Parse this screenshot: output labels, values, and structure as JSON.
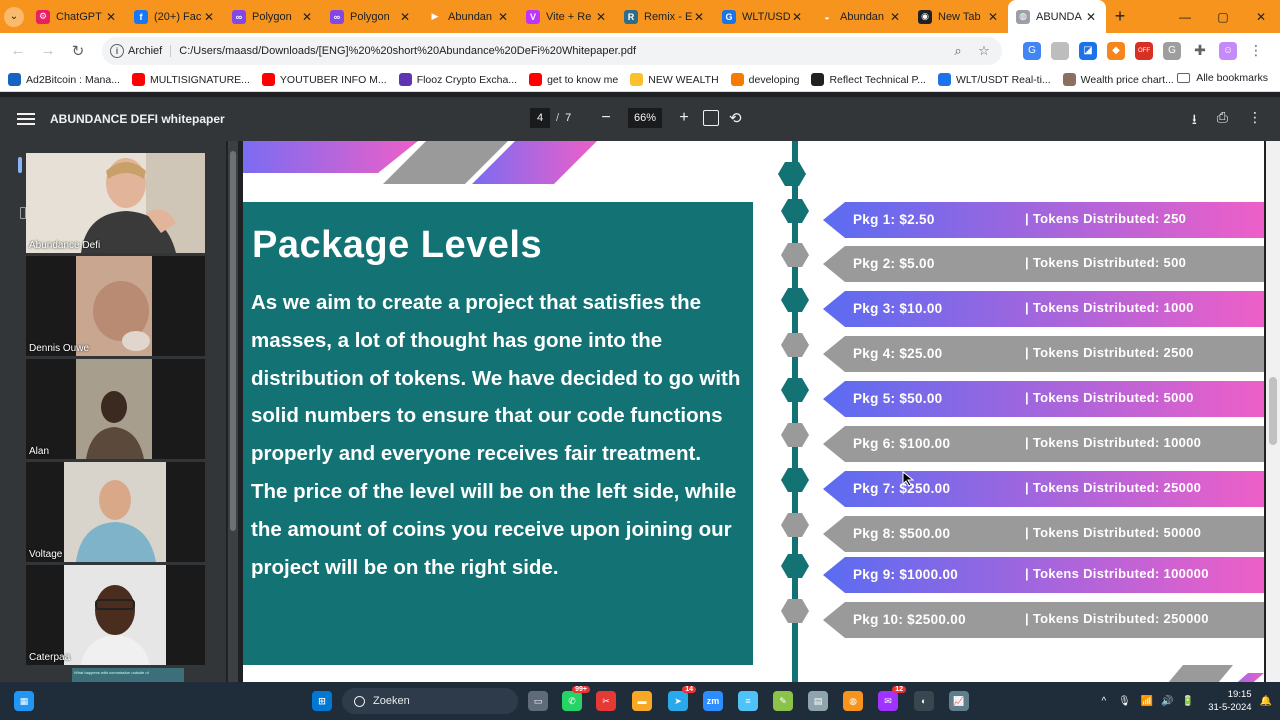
{
  "browser": {
    "tabs": [
      {
        "title": "ChatGPT",
        "color": "#e91e63",
        "glyph": "⚙"
      },
      {
        "title": "(20+) Fac",
        "color": "#1877f2",
        "glyph": "f"
      },
      {
        "title": "Polygon",
        "color": "#8247e5",
        "glyph": "∞"
      },
      {
        "title": "Polygon",
        "color": "#8247e5",
        "glyph": "∞"
      },
      {
        "title": "Abundan",
        "color": "#f7941d",
        "glyph": "▶"
      },
      {
        "title": "Vite + Re",
        "color": "#bd34fe",
        "glyph": "V"
      },
      {
        "title": "Remix - E",
        "color": "#2c6d8c",
        "glyph": "R"
      },
      {
        "title": "WLT/USD",
        "color": "#1a73e8",
        "glyph": "G"
      },
      {
        "title": "Abundan",
        "color": "#f7941d",
        "glyph": "◒"
      },
      {
        "title": "New Tab",
        "color": "#202124",
        "glyph": "◉"
      }
    ],
    "active_tab": {
      "title": "ABUNDA",
      "glyph": "◍"
    },
    "close_glyph": "✕",
    "new_tab_glyph": "+",
    "tab_menu_glyph": "⌄",
    "window": {
      "minimize": "—",
      "maximize": "▢",
      "close": "✕"
    },
    "nav": {
      "back": "←",
      "forward": "→",
      "reload": "↻"
    },
    "address": {
      "chip": "Archief",
      "url": "C:/Users/maasd/Downloads/[ENG]%20%20short%20Abundance%20DeFi%20Whitepaper.pdf",
      "zoom_glyph": "⌕",
      "star_glyph": "☆"
    },
    "extensions": [
      {
        "name": "translate",
        "color": "#4285f4",
        "glyph": "G"
      },
      {
        "name": "ext-grey",
        "color": "#bdbdbd",
        "glyph": ""
      },
      {
        "name": "ext-blue",
        "color": "#1a73e8",
        "glyph": "◪"
      },
      {
        "name": "metamask",
        "color": "#f6851b",
        "glyph": "◆"
      },
      {
        "name": "off-ext",
        "color": "#d93025",
        "glyph": "OFF"
      },
      {
        "name": "ext-g",
        "color": "#9e9e9e",
        "glyph": "G"
      },
      {
        "name": "puzzle",
        "color": "#5f6368",
        "glyph": "✚"
      },
      {
        "name": "profile",
        "color": "#c58af9",
        "glyph": "☺"
      },
      {
        "name": "menu",
        "color": "#5f6368",
        "glyph": "⋮"
      }
    ],
    "bookmarks": [
      {
        "label": "Ad2Bitcoin : Mana...",
        "color": "#1565c0"
      },
      {
        "label": "MULTISIGNATURE...",
        "color": "#ff0000"
      },
      {
        "label": "YOUTUBER INFO M...",
        "color": "#ff0000"
      },
      {
        "label": "Flooz Crypto Excha...",
        "color": "#5e35b1"
      },
      {
        "label": "get to know me",
        "color": "#ff0000"
      },
      {
        "label": "NEW WEALTH",
        "color": "#fbc02d"
      },
      {
        "label": "developing",
        "color": "#f57c00"
      },
      {
        "label": "Reflect Technical P...",
        "color": "#212121"
      },
      {
        "label": "WLT/USDT Real-ti...",
        "color": "#1a73e8"
      },
      {
        "label": "Wealth price chart...",
        "color": "#8d6e63"
      }
    ],
    "all_bookmarks": "Alle bookmarks"
  },
  "pdf": {
    "title": "ABUNDANCE DEFI whitepaper",
    "page_current": "4",
    "page_total": "7",
    "page_separator": "/",
    "zoom": "66%",
    "zoom_out": "−",
    "zoom_in": "+",
    "rotate_glyph": "⟲",
    "download_glyph": "⭳",
    "print_glyph": "⎙",
    "more_glyph": "⋮"
  },
  "participants": [
    {
      "name": "Abundance Defi"
    },
    {
      "name": "Dennis Ouwe"
    },
    {
      "name": "Alan"
    },
    {
      "name": "Voltage"
    },
    {
      "name": "Caterpaa"
    }
  ],
  "chat_preview": "What happens with commission outside of",
  "page_content": {
    "heading": "Package Levels",
    "body": "As we aim to create a project that satisfies the masses, a lot of thought has gone into the distribution of tokens. We have decided to go with solid numbers to ensure that our code functions properly and everyone receives fair treatment. The price of the level will be on the left side, while the amount of coins you receive upon joining our project will be on the right side.",
    "packages": [
      {
        "price": "Pkg 1:  $2.50",
        "tokens": "| Tokens Distributed: 250",
        "style": "gradient"
      },
      {
        "price": "Pkg 2:  $5.00",
        "tokens": "| Tokens Distributed: 500",
        "style": "grey"
      },
      {
        "price": "Pkg 3:  $10.00",
        "tokens": "| Tokens Distributed: 1000",
        "style": "gradient"
      },
      {
        "price": "Pkg 4:  $25.00",
        "tokens": "| Tokens Distributed: 2500",
        "style": "grey"
      },
      {
        "price": "Pkg 5:  $50.00",
        "tokens": "| Tokens Distributed: 5000",
        "style": "gradient"
      },
      {
        "price": "Pkg 6:  $100.00",
        "tokens": "| Tokens Distributed: 10000",
        "style": "grey"
      },
      {
        "price": "Pkg 7:  $250.00",
        "tokens": "| Tokens Distributed: 25000",
        "style": "gradient"
      },
      {
        "price": "Pkg 8:  $500.00",
        "tokens": "| Tokens Distributed: 50000",
        "style": "grey"
      },
      {
        "price": "Pkg 9:  $1000.00",
        "tokens": "| Tokens Distributed: 100000",
        "style": "gradient"
      },
      {
        "price": "Pkg 10:  $2500.00",
        "tokens": "| Tokens Distributed: 250000",
        "style": "grey"
      }
    ],
    "colors": {
      "teal": "#137274",
      "grey": "#9a9a9a",
      "gradient_start": "#5a6cf2",
      "gradient_end": "#ee5fc8"
    }
  },
  "taskbar": {
    "search_placeholder": "Zoeken",
    "apps": [
      {
        "name": "widgets",
        "color": "#2196f3",
        "glyph": "▦",
        "badge": ""
      },
      {
        "name": "start",
        "color": "#0078d4",
        "glyph": "⊞",
        "badge": ""
      },
      {
        "name": "task-view",
        "color": "#5f6b78",
        "glyph": "▭",
        "badge": ""
      },
      {
        "name": "whatsapp",
        "color": "#25d366",
        "glyph": "✆",
        "badge": "99+"
      },
      {
        "name": "snip",
        "color": "#e53935",
        "glyph": "✂",
        "badge": ""
      },
      {
        "name": "explorer",
        "color": "#f9a825",
        "glyph": "▬",
        "badge": ""
      },
      {
        "name": "telegram",
        "color": "#29a9eb",
        "glyph": "➤",
        "badge": "14"
      },
      {
        "name": "zoom",
        "color": "#2d8cff",
        "glyph": "zm",
        "badge": ""
      },
      {
        "name": "notepad",
        "color": "#4fc3f7",
        "glyph": "≡",
        "badge": ""
      },
      {
        "name": "editor",
        "color": "#8bc34a",
        "glyph": "✎",
        "badge": ""
      },
      {
        "name": "calculator",
        "color": "#90a4ae",
        "glyph": "▤",
        "badge": ""
      },
      {
        "name": "chrome",
        "color": "#f7941d",
        "glyph": "◍",
        "badge": ""
      },
      {
        "name": "messenger",
        "color": "#a033ff",
        "glyph": "✉",
        "badge": "12"
      },
      {
        "name": "app-dark",
        "color": "#37474f",
        "glyph": "◐",
        "badge": ""
      },
      {
        "name": "monitor",
        "color": "#607d8b",
        "glyph": "📈",
        "badge": ""
      }
    ],
    "tray": {
      "chevron": "^",
      "mic": "🎙",
      "wifi": "📶",
      "volume": "🔊",
      "battery": "🔋",
      "time": "19:15",
      "date": "31-5-2024",
      "notify": "🔔"
    }
  }
}
